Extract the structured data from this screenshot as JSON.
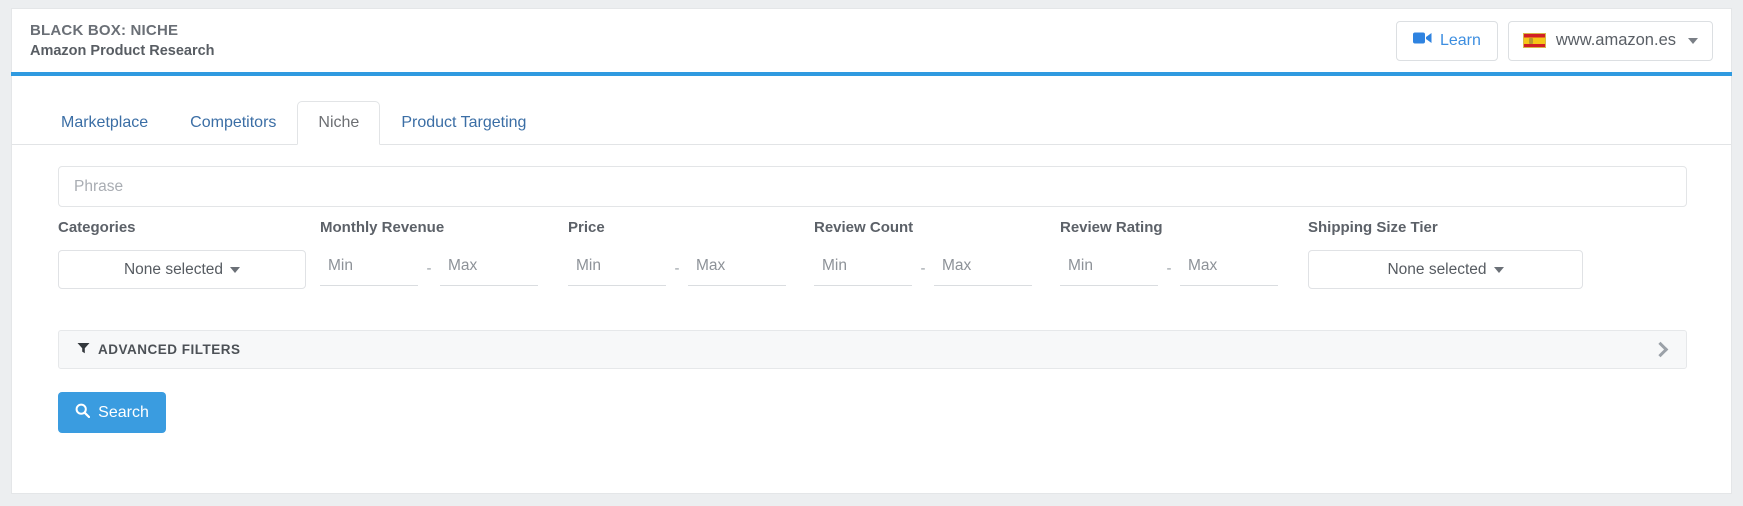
{
  "header": {
    "title": "BLACK BOX: NICHE",
    "subtitle": "Amazon Product Research",
    "learn_label": "Learn",
    "learn_icon": "video-camera-icon",
    "marketplace_label": "www.amazon.es",
    "marketplace_flag": "spain-flag-icon",
    "marketplace_caret": "chevron-down-icon"
  },
  "tabs": [
    {
      "label": "Marketplace",
      "active": false
    },
    {
      "label": "Competitors",
      "active": false
    },
    {
      "label": "Niche",
      "active": true
    },
    {
      "label": "Product Targeting",
      "active": false
    }
  ],
  "search_form": {
    "phrase": {
      "placeholder": "Phrase",
      "value": ""
    },
    "filters": [
      {
        "label": "Categories",
        "type": "dropdown",
        "value": "None selected",
        "caret_icon": "caret-down-icon"
      },
      {
        "label": "Monthly Revenue",
        "type": "range",
        "min_placeholder": "Min",
        "max_placeholder": "Max",
        "separator": "-",
        "min_value": "",
        "max_value": ""
      },
      {
        "label": "Price",
        "type": "range",
        "min_placeholder": "Min",
        "max_placeholder": "Max",
        "separator": "-",
        "min_value": "",
        "max_value": ""
      },
      {
        "label": "Review Count",
        "type": "range",
        "min_placeholder": "Min",
        "max_placeholder": "Max",
        "separator": "-",
        "min_value": "",
        "max_value": ""
      },
      {
        "label": "Review Rating",
        "type": "range",
        "min_placeholder": "Min",
        "max_placeholder": "Max",
        "separator": "-",
        "min_value": "",
        "max_value": ""
      },
      {
        "label": "Shipping Size Tier",
        "type": "dropdown",
        "value": "None selected",
        "caret_icon": "caret-down-icon"
      }
    ],
    "advanced_filters": {
      "label": "ADVANCED FILTERS",
      "funnel_icon": "funnel-icon",
      "expand_icon": "chevron-right-icon",
      "expanded": false
    },
    "search_button": {
      "label": "Search",
      "icon": "magnifier-icon"
    }
  },
  "colors": {
    "accent_blue": "#3a9ce0",
    "link_blue": "#3b6ea5",
    "header_rule": "#2f9ae0",
    "page_bg": "#eceef0"
  }
}
